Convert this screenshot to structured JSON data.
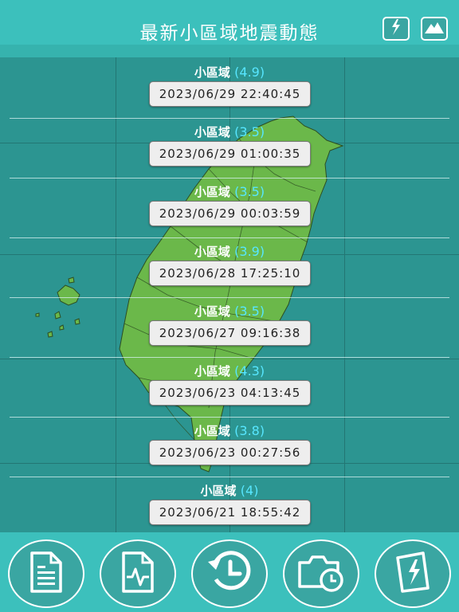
{
  "header": {
    "title": "最新小區域地震動態",
    "icons": [
      "quake-icon",
      "mountain-icon"
    ]
  },
  "entries": [
    {
      "label": "小區域",
      "magnitude": "(4.9)",
      "time": "2023/06/29 22:40:45"
    },
    {
      "label": "小區域",
      "magnitude": "(3.5)",
      "time": "2023/06/29 01:00:35"
    },
    {
      "label": "小區域",
      "magnitude": "(3.5)",
      "time": "2023/06/29 00:03:59"
    },
    {
      "label": "小區域",
      "magnitude": "(3.9)",
      "time": "2023/06/28 17:25:10"
    },
    {
      "label": "小區域",
      "magnitude": "(3.5)",
      "time": "2023/06/27 09:16:38"
    },
    {
      "label": "小區域",
      "magnitude": "(4.3)",
      "time": "2023/06/23 04:13:45"
    },
    {
      "label": "小區域",
      "magnitude": "(3.8)",
      "time": "2023/06/23 00:27:56"
    },
    {
      "label": "小區域",
      "magnitude": "(4)",
      "time": "2023/06/21 18:55:42"
    }
  ],
  "footer": {
    "icons": [
      "report-document-icon",
      "seismogram-icon",
      "history-icon",
      "camera-clock-icon",
      "quake-card-icon"
    ]
  },
  "colors": {
    "header": "#3cc0bc",
    "map_water": "#2c9591",
    "land": "#6bb84a",
    "magnitude": "#57e6ff"
  }
}
